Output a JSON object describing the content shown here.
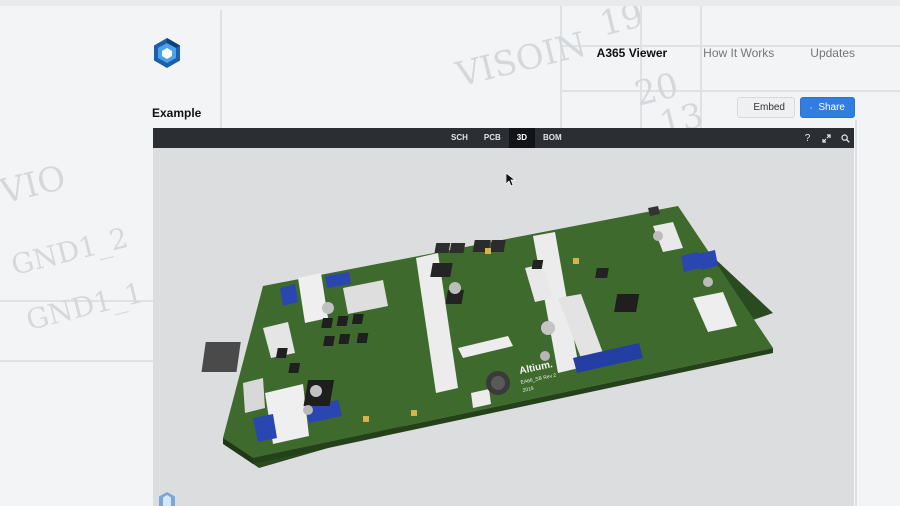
{
  "nav": {
    "items": [
      {
        "label": "A365 Viewer",
        "active": true
      },
      {
        "label": "How It Works",
        "active": false
      },
      {
        "label": "Updates",
        "active": false
      }
    ]
  },
  "example": {
    "title": "Example"
  },
  "actions": {
    "embed_label": "Embed",
    "share_label": "Share"
  },
  "viewer": {
    "tabs": [
      {
        "label": "SCH",
        "active": false
      },
      {
        "label": "PCB",
        "active": false
      },
      {
        "label": "3D",
        "active": true
      },
      {
        "label": "BOM",
        "active": false
      }
    ],
    "icons": [
      "help-icon",
      "fullscreen-icon",
      "search-icon"
    ]
  },
  "board": {
    "silkscreen": [
      "Altium.",
      "EA66_SB Rev 2",
      "2019"
    ]
  },
  "background": {
    "sketch_text": [
      "VISOIN",
      "GND1_2",
      "GND1_1",
      "20",
      "19",
      "13",
      "VIO"
    ]
  },
  "colors": {
    "accent": "#2f7ee0",
    "pcb": "#3e6b2d",
    "connector_blue": "#2a46b0",
    "toolbar": "#2b2e33"
  }
}
